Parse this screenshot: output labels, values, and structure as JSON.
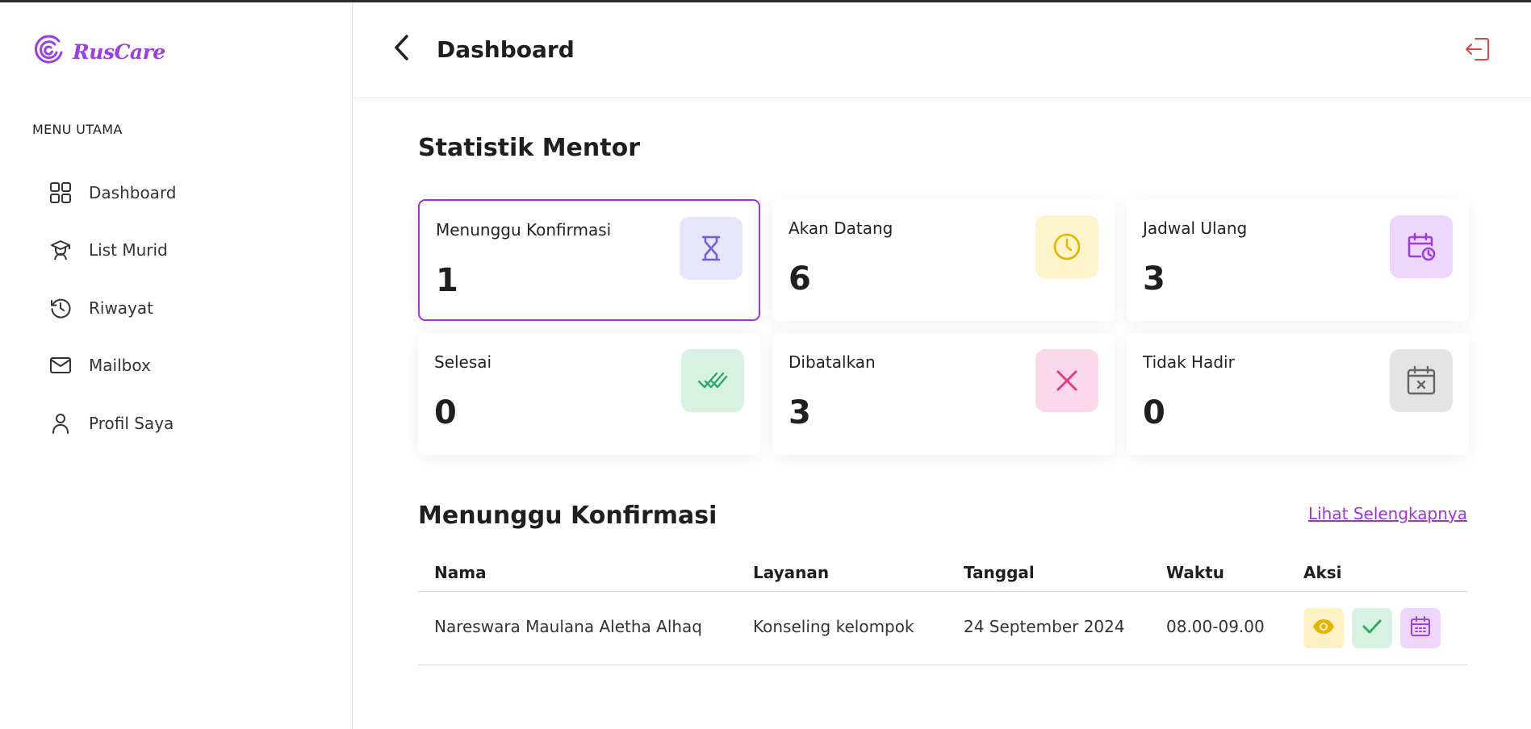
{
  "brand": {
    "name": "RusCare",
    "color": "#9b3fe0"
  },
  "sidebar": {
    "menu_title": "MENU UTAMA",
    "items": [
      {
        "label": "Dashboard",
        "icon": "grid-icon"
      },
      {
        "label": "List Murid",
        "icon": "student-icon"
      },
      {
        "label": "Riwayat",
        "icon": "history-icon"
      },
      {
        "label": "Mailbox",
        "icon": "mail-icon"
      },
      {
        "label": "Profil Saya",
        "icon": "user-icon"
      }
    ]
  },
  "header": {
    "title": "Dashboard"
  },
  "stats": {
    "title": "Statistik Mentor",
    "cards": [
      {
        "label": "Menunggu Konfirmasi",
        "value": "1",
        "icon": "hourglass-icon",
        "icon_bg": "#e6e6fb",
        "icon_color": "#6c63d9"
      },
      {
        "label": "Akan Datang",
        "value": "6",
        "icon": "clock-icon",
        "icon_bg": "#fdf4c9",
        "icon_color": "#e5b400"
      },
      {
        "label": "Jadwal Ulang",
        "value": "3",
        "icon": "calendar-clock-icon",
        "icon_bg": "#ecd6fb",
        "icon_color": "#9b3fe0"
      },
      {
        "label": "Selesai",
        "value": "0",
        "icon": "double-check-icon",
        "icon_bg": "#d7f2e2",
        "icon_color": "#34a56a"
      },
      {
        "label": "Dibatalkan",
        "value": "3",
        "icon": "x-icon",
        "icon_bg": "#fbd8ea",
        "icon_color": "#e6398a"
      },
      {
        "label": "Tidak Hadir",
        "value": "0",
        "icon": "calendar-x-icon",
        "icon_bg": "#e4e4e4",
        "icon_color": "#666666"
      }
    ]
  },
  "pending": {
    "title": "Menunggu Konfirmasi",
    "see_more": "Lihat Selengkapnya",
    "columns": [
      "Nama",
      "Layanan",
      "Tanggal",
      "Waktu",
      "Aksi"
    ],
    "rows": [
      {
        "nama": "Nareswara Maulana Aletha Alhaq",
        "layanan": "Konseling kelompok",
        "tanggal": "24 September 2024",
        "waktu": "08.00-09.00"
      }
    ],
    "actions": [
      {
        "icon": "eye-icon",
        "bg": "#fdf0c4",
        "color": "#e5b400"
      },
      {
        "icon": "check-icon",
        "bg": "#d7f2e2",
        "color": "#2fae5e"
      },
      {
        "icon": "calendar-icon",
        "bg": "#ecd6fb",
        "color": "#9b3fe0"
      }
    ]
  }
}
